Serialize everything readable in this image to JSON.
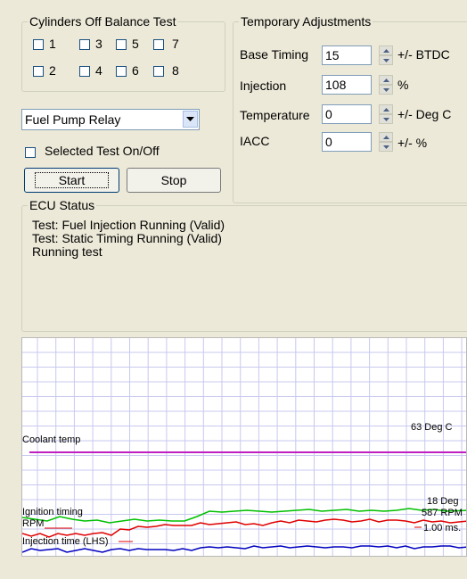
{
  "cylinders": {
    "title": "Cylinders Off Balance Test",
    "row1": [
      "1",
      "3",
      "5",
      "7"
    ],
    "row2": [
      "2",
      "4",
      "6",
      "8"
    ]
  },
  "relay_select": {
    "value": "Fuel Pump Relay",
    "icon": "chevron-down-icon"
  },
  "selected_test": {
    "label": "Selected Test On/Off",
    "checked": false
  },
  "buttons": {
    "start": "Start",
    "stop": "Stop"
  },
  "temp_adj": {
    "title": "Temporary Adjustments",
    "rows": [
      {
        "label": "Base Timing",
        "value": "15",
        "unit": "+/- BTDC"
      },
      {
        "label": "Injection",
        "value": "108",
        "unit": "%"
      },
      {
        "label": "Temperature",
        "value": "0",
        "unit": "+/- Deg C"
      },
      {
        "label": "IACC",
        "value": "0",
        "unit": "+/- %"
      }
    ]
  },
  "ecu_status": {
    "title": "ECU Status",
    "lines": [
      "Test: Fuel Injection Running (Valid)",
      "Test: Static Timing Running (Valid)",
      "Running test"
    ]
  },
  "graph": {
    "coolant": {
      "label": "Coolant temp",
      "value": "63 Deg C",
      "color": "#c020c0"
    },
    "ignition": {
      "label": "Ignition timing",
      "value": "18 Deg",
      "color": "#00c000"
    },
    "rpm": {
      "label": "RPM",
      "value": "587 RPM",
      "color": "#e00000"
    },
    "injection": {
      "label": "Injection time (LHS)",
      "value": "1.00 ms.",
      "color": "#0000c0"
    },
    "grid_color": "#c8c8f0"
  }
}
